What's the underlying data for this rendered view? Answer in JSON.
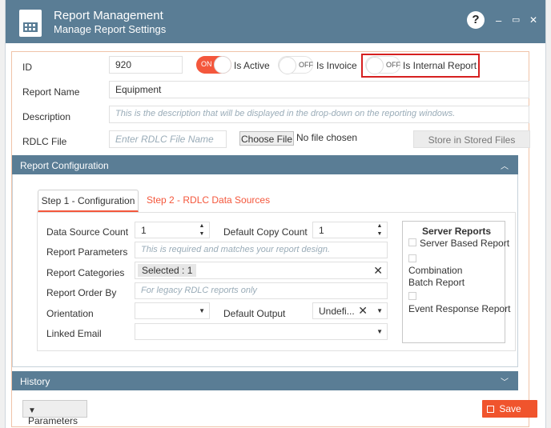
{
  "window": {
    "title": "Report Management",
    "subtitle": "Manage Report Settings",
    "help": "?",
    "min": "–",
    "max": "▭",
    "close": "✕"
  },
  "form": {
    "id_label": "ID",
    "id_value": "920",
    "is_active_label": "Is Active",
    "is_active_state": "ON",
    "is_invoice_label": "Is Invoice",
    "is_invoice_state": "OFF",
    "is_internal_label": "Is Internal Report",
    "is_internal_state": "OFF",
    "report_name_label": "Report Name",
    "report_name_value": "Equipment",
    "description_label": "Description",
    "description_placeholder": "This is the description that will be displayed in the drop-down on the reporting windows.",
    "rdlc_label": "RDLC File",
    "rdlc_placeholder": "Enter RDLC File Name",
    "choose_file": "Choose File",
    "no_file": "No file chosen",
    "store_button": "Store in Stored Files"
  },
  "config": {
    "header": "Report Configuration",
    "tab1": "Step 1 - Configuration",
    "tab2": "Step 2 - RDLC Data Sources",
    "ds_count_label": "Data Source Count",
    "ds_count_value": "1",
    "copy_count_label": "Default Copy Count",
    "copy_count_value": "1",
    "params_label": "Report Parameters",
    "params_placeholder": "This is required and matches your report design.",
    "categories_label": "Report Categories",
    "categories_chip": "Selected : 1",
    "order_label": "Report Order By",
    "order_placeholder": "For legacy RDLC reports only",
    "orientation_label": "Orientation",
    "output_label": "Default Output",
    "output_value": "Undefi...",
    "email_label": "Linked Email"
  },
  "server_reports": {
    "title": "Server Reports",
    "item1": "Server Based Report",
    "item2": "Combination Batch Report",
    "item3": "Event Response Report"
  },
  "history": {
    "header": "History"
  },
  "footer": {
    "parameters": "Parameters",
    "save": "Save"
  },
  "colors": {
    "titlebar": "#5a7d95",
    "accent": "#f4573c",
    "highlight": "#d62020"
  }
}
